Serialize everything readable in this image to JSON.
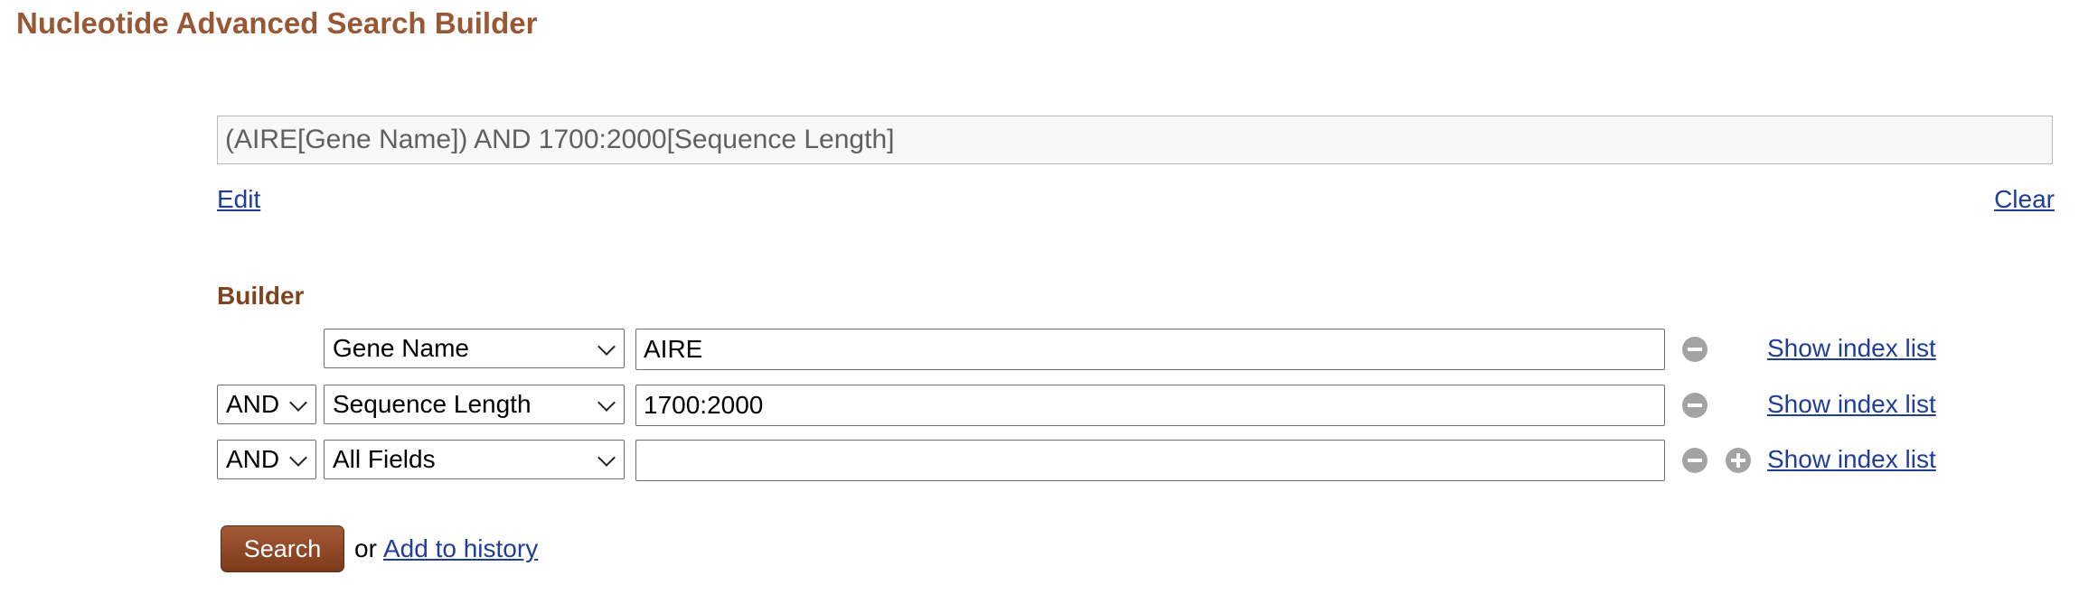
{
  "header": {
    "title": "Nucleotide Advanced Search Builder"
  },
  "query": {
    "text": "(AIRE[Gene Name]) AND 1700:2000[Sequence Length]",
    "edit_label": "Edit",
    "clear_label": "Clear"
  },
  "builder": {
    "heading": "Builder",
    "rows": [
      {
        "operator": "",
        "field": "Gene Name",
        "term": "AIRE",
        "index_label": "Show index list"
      },
      {
        "operator": "AND",
        "field": "Sequence Length",
        "term": "1700:2000",
        "index_label": "Show index list"
      },
      {
        "operator": "AND",
        "field": "All Fields",
        "term": "",
        "index_label": "Show index list"
      }
    ]
  },
  "actions": {
    "search_label": "Search",
    "or_text": "or",
    "history_label": "Add to history"
  },
  "icons": {
    "remove_row": "minus-circle-icon",
    "add_row": "plus-circle-icon",
    "dropdown": "chevron-down-icon"
  },
  "colors": {
    "title": "#985735",
    "builder_heading": "#7e4420",
    "link": "#1f3d99",
    "search_button": "#8f4726",
    "round_button": "#a3a3a3"
  }
}
